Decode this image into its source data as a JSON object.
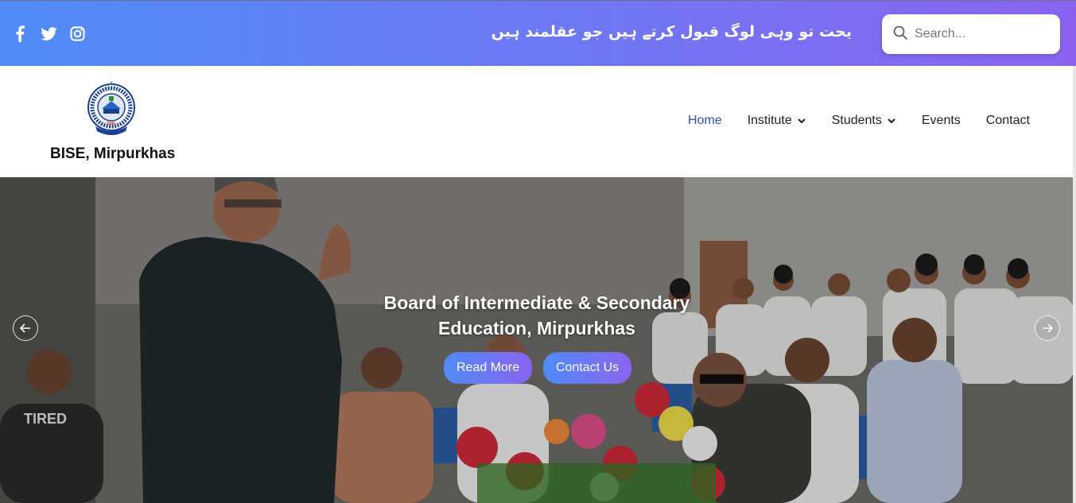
{
  "topbar": {
    "social": [
      "facebook-icon",
      "twitter-icon",
      "instagram-icon"
    ],
    "tagline": "یحت تو وہی لوگ قبول کرتے ہیں جو عقلمند ہیں",
    "search_placeholder": "Search...",
    "gradient": [
      "#4f8cf7",
      "#8a64f0"
    ]
  },
  "header": {
    "brand": "BISE, Mirpurkhas",
    "logo_text": "BMK",
    "nav": [
      {
        "label": "Home",
        "active": true
      },
      {
        "label": "Institute",
        "dropdown": true
      },
      {
        "label": "Students",
        "dropdown": true
      },
      {
        "label": "Events"
      },
      {
        "label": "Contact"
      }
    ],
    "active_color": "#3451b2"
  },
  "hero": {
    "title_line1": "Board of Intermediate & Secondary",
    "title_line2": "Education, Mirpurkhas",
    "read_more": "Read More",
    "contact_us": "Contact Us",
    "shirt_text": "TIRED"
  }
}
